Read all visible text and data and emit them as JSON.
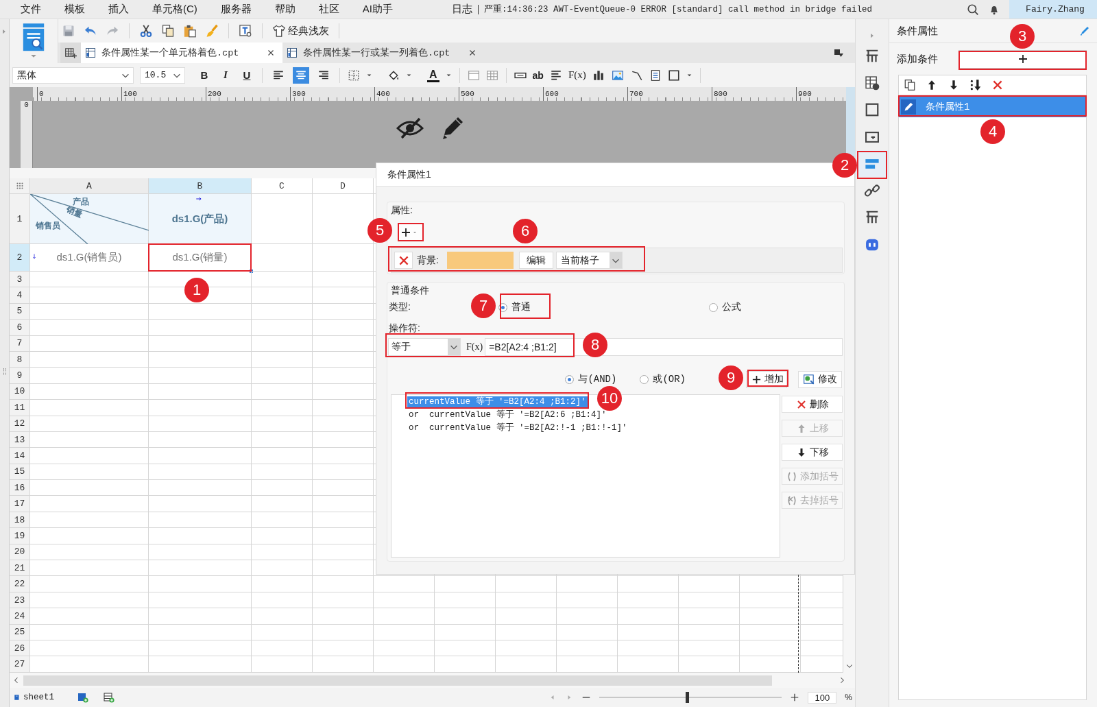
{
  "menu": {
    "items": [
      "文件",
      "模板",
      "插入",
      "单元格(C)",
      "服务器",
      "帮助",
      "社区",
      "AI助手"
    ],
    "log_label": "日志",
    "log_message": "严重:14:36:23 AWT-EventQueue-0 ERROR [standard] call method in bridge failed",
    "user": "Fairy.Zhang"
  },
  "toolbar": {
    "theme_button": "经典浅灰"
  },
  "file_tabs": [
    {
      "label": "条件属性某一个单元格着色.cpt",
      "selected": true
    },
    {
      "label": "条件属性某一行或某一列着色.cpt",
      "selected": false
    }
  ],
  "format_bar": {
    "font": "黑体",
    "size": "10.5",
    "style_buttons": [
      "B",
      "I",
      "U"
    ],
    "alignments": [
      {
        "selected": false
      },
      {
        "selected": true
      },
      {
        "selected": false
      }
    ],
    "font_color_glyph": "A",
    "text_glyph": "ab",
    "formula_glyph": "F(x)"
  },
  "ruler": {
    "h_labels": [
      "0",
      "100",
      "200",
      "300",
      "400",
      "500",
      "600",
      "700",
      "800",
      "900"
    ],
    "v_label": "0"
  },
  "sheet": {
    "columns": [
      {
        "label": "A",
        "selected": false
      },
      {
        "label": "B",
        "selected": true
      },
      {
        "label": "C",
        "selected": false
      },
      {
        "label": "D",
        "selected": false
      }
    ],
    "rows": [
      {
        "label": "1",
        "selected": false
      },
      {
        "label": "2",
        "selected": true
      },
      {
        "label": "3",
        "selected": false
      },
      {
        "label": "4",
        "selected": false
      },
      {
        "label": "5",
        "selected": false
      },
      {
        "label": "6",
        "selected": false
      },
      {
        "label": "7",
        "selected": false
      },
      {
        "label": "8",
        "selected": false
      },
      {
        "label": "9",
        "selected": false
      },
      {
        "label": "10",
        "selected": false
      },
      {
        "label": "11",
        "selected": false
      },
      {
        "label": "12",
        "selected": false
      },
      {
        "label": "13",
        "selected": false
      },
      {
        "label": "14",
        "selected": false
      },
      {
        "label": "15",
        "selected": false
      },
      {
        "label": "16",
        "selected": false
      },
      {
        "label": "17",
        "selected": false
      },
      {
        "label": "18",
        "selected": false
      },
      {
        "label": "19",
        "selected": false
      },
      {
        "label": "20",
        "selected": false
      },
      {
        "label": "21",
        "selected": false
      },
      {
        "label": "22",
        "selected": false
      },
      {
        "label": "23",
        "selected": false
      },
      {
        "label": "24",
        "selected": false
      },
      {
        "label": "25",
        "selected": false
      },
      {
        "label": "26",
        "selected": false
      },
      {
        "label": "27",
        "selected": false
      }
    ],
    "diagonal_header": {
      "top": "产品",
      "middle": "销量",
      "bottom": "销售员"
    },
    "b1": "ds1.G(产品)",
    "a2": "ds1.G(销售员)",
    "b2": "ds1.G(销量)"
  },
  "bottom_bar": {
    "sheet_tab": "sheet1",
    "zoom": "100",
    "zoom_unit": "%",
    "level": 0.48
  },
  "dialog": {
    "title": "条件属性1",
    "attributes_label": "属性:",
    "attribute": {
      "label": "背景:",
      "color": "#f8c97c",
      "edit": "编辑",
      "scope": "当前格子"
    },
    "conditions_label": "普通条件",
    "type_label": "类型:",
    "types": [
      {
        "label": "普通",
        "selected": true
      },
      {
        "label": "公式",
        "selected": false
      }
    ],
    "operator_label": "操作符:",
    "operator": "等于",
    "fx": "F(x)",
    "formula": "=B2[A2:4 ;B1:2]",
    "logic": [
      {
        "label": "与(AND)",
        "selected": true
      },
      {
        "label": "或(OR)",
        "selected": false
      }
    ],
    "add": "增加",
    "modify": "修改",
    "conditions": [
      {
        "text": "currentValue 等于 '=B2[A2:4 ;B1:2]'",
        "selected": true
      },
      {
        "text": "or  currentValue 等于 '=B2[A2:6 ;B1:4]'",
        "selected": false
      },
      {
        "text": "or  currentValue 等于 '=B2[A2:!-1 ;B1:!-1]'",
        "selected": false
      }
    ],
    "side_buttons": [
      {
        "label": "删除",
        "kind": "delete",
        "disabled": false
      },
      {
        "label": "上移",
        "kind": "up",
        "disabled": true
      },
      {
        "label": "下移",
        "kind": "down",
        "disabled": false
      },
      {
        "label": "添加括号",
        "kind": "add_paren",
        "disabled": true
      },
      {
        "label": "去掉括号",
        "kind": "remove_paren",
        "disabled": true
      }
    ]
  },
  "side_strip": [
    {
      "selected": false
    },
    {
      "selected": false
    },
    {
      "selected": false
    },
    {
      "selected": false
    },
    {
      "selected": true
    },
    {
      "selected": false
    },
    {
      "selected": false
    },
    {
      "selected": false
    }
  ],
  "right_panel": {
    "title": "条件属性",
    "add_label": "添加条件",
    "items": [
      {
        "label": "条件属性1",
        "selected": true
      }
    ]
  },
  "annotations": [
    {
      "number": "1"
    },
    {
      "number": "2"
    },
    {
      "number": "3"
    },
    {
      "number": "4"
    },
    {
      "number": "5"
    },
    {
      "number": "6"
    },
    {
      "number": "7"
    },
    {
      "number": "8"
    },
    {
      "number": "9"
    },
    {
      "number": "10"
    }
  ]
}
